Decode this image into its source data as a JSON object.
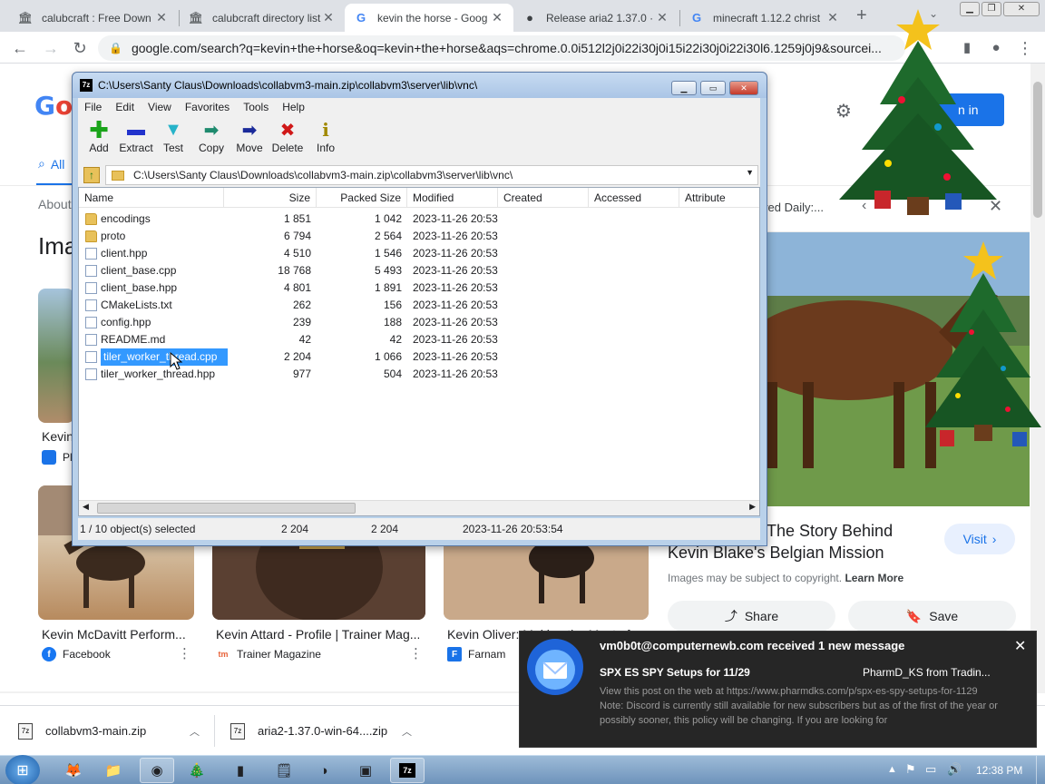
{
  "browser": {
    "tabs": [
      {
        "title": "calubcraft : Free Down",
        "icon": "archive-icon"
      },
      {
        "title": "calubcraft directory list",
        "icon": "archive-icon"
      },
      {
        "title": "kevin the horse - Goog",
        "icon": "google-icon"
      },
      {
        "title": "Release aria2 1.37.0 · a",
        "icon": "github-icon"
      },
      {
        "title": "minecraft 1.12.2 christ",
        "icon": "google-icon"
      }
    ],
    "url": "google.com/search?q=kevin+the+horse&oq=kevin+the+horse&aqs=chrome.0.0i512l2j0i22i30j0i15i22i30j0i22i30l6.1259j0j9&sourcei..."
  },
  "google": {
    "logo": "Go",
    "tab_all": "All",
    "about": "About",
    "images_heading": "Ima",
    "sign_in": "n in",
    "partial_caption_1": "Kevin",
    "partial_source_1": "Pl",
    "results": [
      {
        "caption": "Kevin McDavitt Perform...",
        "source": "Facebook",
        "icon_letter": "f",
        "icon_color": "#1877f2"
      },
      {
        "caption": "Kevin Attard - Profile | Trainer Mag...",
        "source": "Trainer Magazine",
        "icon_letter": "tm",
        "icon_color": "#e8633a"
      },
      {
        "caption": "Kevin Oliver: Making the Most of...",
        "source": "Farnam",
        "icon_letter": "F",
        "icon_color": "#1a73e8"
      }
    ],
    "preview": {
      "sponsored": "ored Daily:...",
      "title_line1": "The Story Behind",
      "title_line2": "Kevin Blake's Belgian Mission",
      "visit": "Visit",
      "copyright": "Images may be subject to copyright.",
      "learn_more": "Learn More",
      "share": "Share",
      "save": "Save"
    }
  },
  "zip": {
    "title": "C:\\Users\\Santy Claus\\Downloads\\collabvm3-main.zip\\collabvm3\\server\\lib\\vnc\\",
    "menu": [
      "File",
      "Edit",
      "View",
      "Favorites",
      "Tools",
      "Help"
    ],
    "tools": [
      {
        "label": "Add",
        "glyph": "+",
        "color": "#1aa31a"
      },
      {
        "label": "Extract",
        "glyph": "▬",
        "color": "#2233cc"
      },
      {
        "label": "Test",
        "glyph": "▼",
        "color": "#27b3c9"
      },
      {
        "label": "Copy",
        "glyph": "➡",
        "color": "#1e8a6e"
      },
      {
        "label": "Move",
        "glyph": "➡",
        "color": "#1a2a9a"
      },
      {
        "label": "Delete",
        "glyph": "✖",
        "color": "#d01818"
      },
      {
        "label": "Info",
        "glyph": "i",
        "color": "#a08800"
      }
    ],
    "address": "C:\\Users\\Santy Claus\\Downloads\\collabvm3-main.zip\\collabvm3\\server\\lib\\vnc\\",
    "columns": [
      "Name",
      "Size",
      "Packed Size",
      "Modified",
      "Created",
      "Accessed",
      "Attribute"
    ],
    "rows": [
      {
        "name": "encodings",
        "size": "1 851",
        "packed": "1 042",
        "modified": "2023-11-26 20:53",
        "type": "folder"
      },
      {
        "name": "proto",
        "size": "6 794",
        "packed": "2 564",
        "modified": "2023-11-26 20:53",
        "type": "folder"
      },
      {
        "name": "client.hpp",
        "size": "4 510",
        "packed": "1 546",
        "modified": "2023-11-26 20:53",
        "type": "file"
      },
      {
        "name": "client_base.cpp",
        "size": "18 768",
        "packed": "5 493",
        "modified": "2023-11-26 20:53",
        "type": "file"
      },
      {
        "name": "client_base.hpp",
        "size": "4 801",
        "packed": "1 891",
        "modified": "2023-11-26 20:53",
        "type": "file"
      },
      {
        "name": "CMakeLists.txt",
        "size": "262",
        "packed": "156",
        "modified": "2023-11-26 20:53",
        "type": "file"
      },
      {
        "name": "config.hpp",
        "size": "239",
        "packed": "188",
        "modified": "2023-11-26 20:53",
        "type": "file"
      },
      {
        "name": "README.md",
        "size": "42",
        "packed": "42",
        "modified": "2023-11-26 20:53",
        "type": "file"
      },
      {
        "name": "tiler_worker_thread.cpp",
        "size": "2 204",
        "packed": "1 066",
        "modified": "2023-11-26 20:53",
        "type": "file",
        "selected": true
      },
      {
        "name": "tiler_worker_thread.hpp",
        "size": "977",
        "packed": "504",
        "modified": "2023-11-26 20:53",
        "type": "file"
      }
    ],
    "status": {
      "selection": "1 / 10 object(s) selected",
      "size": "2 204",
      "packed": "2 204",
      "modified": "2023-11-26 20:53:54"
    }
  },
  "downloads": [
    {
      "name": "collabvm3-main.zip"
    },
    {
      "name": "aria2-1.37.0-win-64....zip"
    }
  ],
  "notification": {
    "header": "vm0b0t@computernewb.com received 1 new message",
    "subject": "SPX ES SPY Setups for 11/29",
    "sender": "PharmD_KS from Tradin...",
    "body": "View this post on the web at https://www.pharmdks.com/p/spx-es-spy-setups-for-1129 Note: Discord is currently still available for new subscribers but as of the first of the year or possibly sooner, this policy will be changing. If you are looking for"
  },
  "taskbar": {
    "clock": "12:38 PM"
  }
}
